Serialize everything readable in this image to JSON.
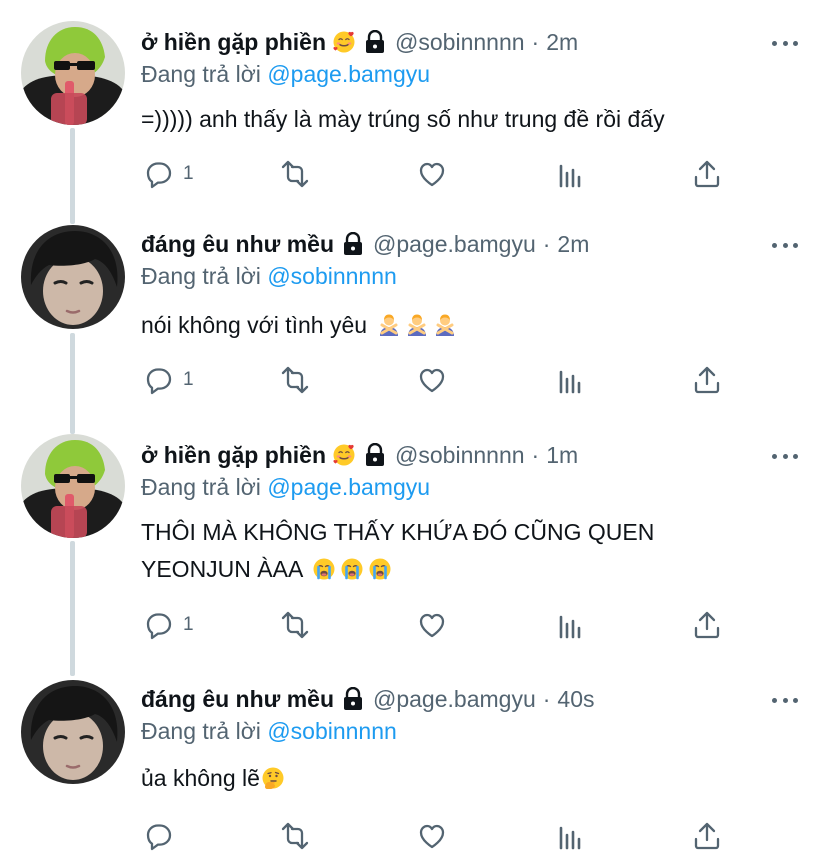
{
  "tweets": [
    {
      "display_name": "ở hiền gặp phiền",
      "name_emoji": "smiling-face-with-hearts-emoji",
      "handle": "@sobinnnnn",
      "dot": "·",
      "time": "2m",
      "reply_prefix": "Đang trả lời",
      "reply_to": "@page.bamgyu",
      "text_lines": [
        "=))))) anh thấy là mày trúng số như trung đề rồi đấy"
      ],
      "reply_count": "1",
      "avatar": "green-hood-avatar"
    },
    {
      "display_name": "đáng êu như mều",
      "handle": "@page.bamgyu",
      "dot": "·",
      "time": "2m",
      "reply_prefix": "Đang trả lời",
      "reply_to": "@sobinnnnn",
      "text_lines": [
        "nói không với tình yêu"
      ],
      "text_emoji": [
        "person-gesturing-no-emoji",
        "person-gesturing-no-emoji",
        "person-gesturing-no-emoji"
      ],
      "reply_count": "1",
      "avatar": "dark-hair-avatar"
    },
    {
      "display_name": "ở hiền gặp phiền",
      "name_emoji": "smiling-face-with-hearts-emoji",
      "handle": "@sobinnnnn",
      "dot": "·",
      "time": "1m",
      "reply_prefix": "Đang trả lời",
      "reply_to": "@page.bamgyu",
      "text_lines": [
        "THÔI MÀ KHÔNG THẤY KHỨA ĐÓ CŨNG QUEN",
        "YEONJUN ÀAA"
      ],
      "text_emoji": [
        "loudly-crying-face-emoji",
        "loudly-crying-face-emoji",
        "loudly-crying-face-emoji"
      ],
      "reply_count": "1",
      "avatar": "green-hood-avatar"
    },
    {
      "display_name": "đáng êu như mều",
      "handle": "@page.bamgyu",
      "dot": "·",
      "time": "40s",
      "reply_prefix": "Đang trả lời",
      "reply_to": "@sobinnnnn",
      "text_lines": [
        "ủa không lẽ"
      ],
      "text_emoji": [
        "thinking-face-emoji"
      ],
      "reply_count": "",
      "avatar": "dark-hair-avatar"
    }
  ],
  "icons": {
    "reply": "reply-icon",
    "retweet": "retweet-icon",
    "like": "heart-icon",
    "analytics": "analytics-icon",
    "share": "share-icon",
    "more": "more-icon",
    "lock": "lock-icon"
  },
  "colors": {
    "link": "#1d9bf0",
    "secondary": "#536471",
    "text": "#0f1419",
    "thread_line": "#cfd9de"
  }
}
